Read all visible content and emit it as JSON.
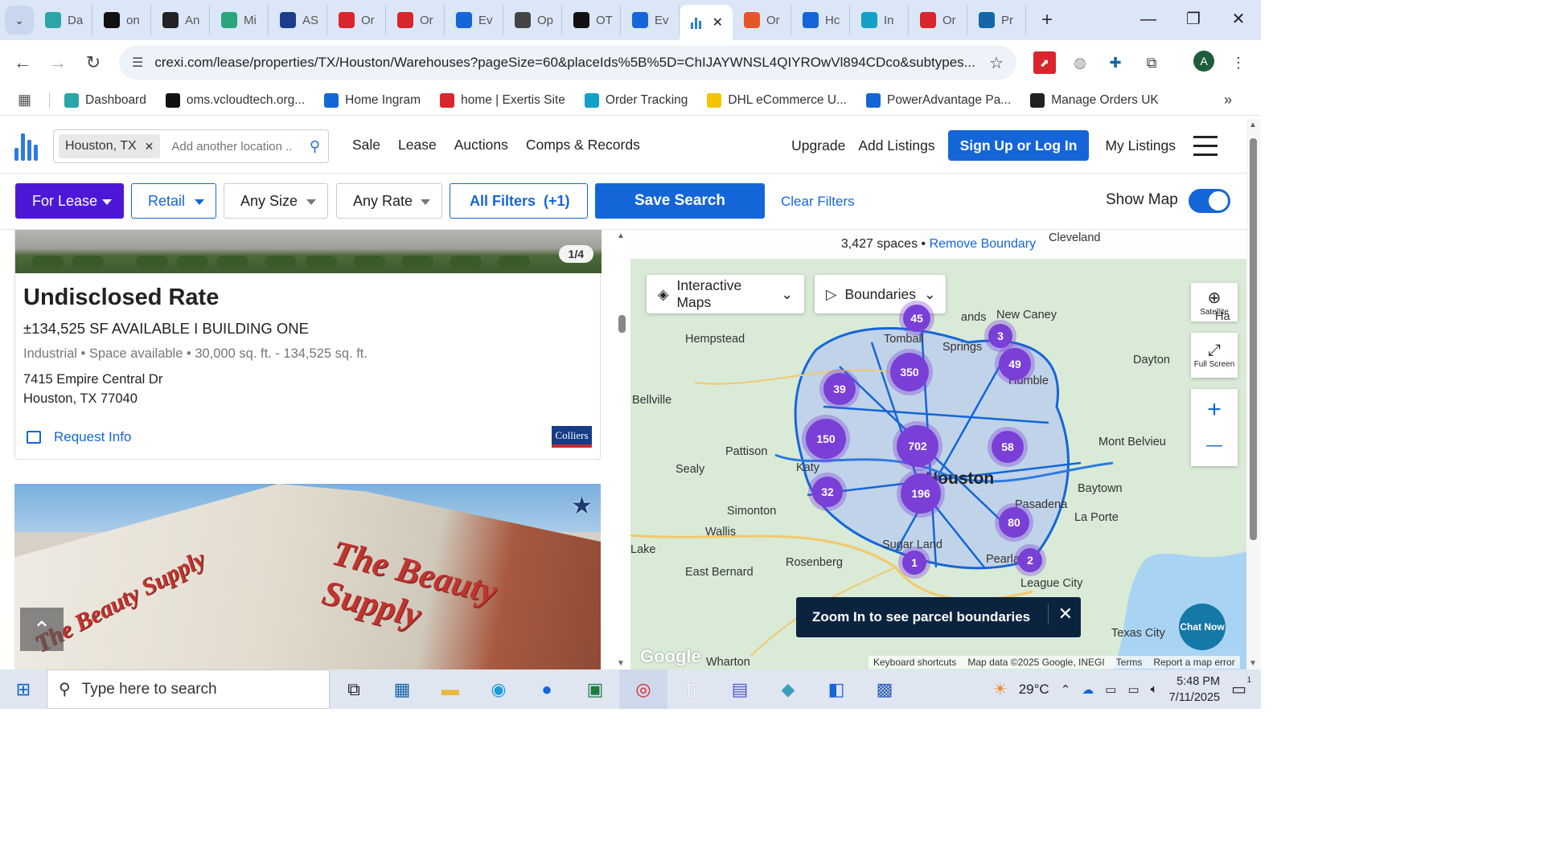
{
  "browser": {
    "tabs": [
      {
        "label": "Da",
        "color": "#2aa6a6"
      },
      {
        "label": "on",
        "color": "#111111"
      },
      {
        "label": "An",
        "color": "#222222"
      },
      {
        "label": "Mi",
        "color": "#2aa67a"
      },
      {
        "label": "AS",
        "color": "#1d3c8c"
      },
      {
        "label": "Or",
        "color": "#d8262c"
      },
      {
        "label": "Or",
        "color": "#d8262c"
      },
      {
        "label": "Ev",
        "color": "#1466d8"
      },
      {
        "label": "Op",
        "color": "#444444"
      },
      {
        "label": "OT",
        "color": "#111111"
      },
      {
        "label": "Ev",
        "color": "#1466d8"
      }
    ],
    "active_tab_close": "✕",
    "tabs_after": [
      {
        "label": "Or",
        "color": "#e8542a"
      },
      {
        "label": "Hc",
        "color": "#1466d8"
      },
      {
        "label": "In",
        "color": "#12a0c8"
      },
      {
        "label": "Or",
        "color": "#d8262c"
      },
      {
        "label": "Pr",
        "color": "#1466a8"
      }
    ],
    "url": "crexi.com/lease/properties/TX/Houston/Warehouses?pageSize=60&placeIds%5B%5D=ChIJAYWNSL4QIYROwVl894CDco&subtypes...",
    "avatar_letter": "A",
    "bookmarks": [
      {
        "label": "Dashboard",
        "color": "#2aa6a6"
      },
      {
        "label": "oms.vcloudtech.org...",
        "color": "#111111"
      },
      {
        "label": "Home Ingram",
        "color": "#1466d8"
      },
      {
        "label": "home | Exertis Site",
        "color": "#d8262c"
      },
      {
        "label": "Order Tracking",
        "color": "#12a0c8"
      },
      {
        "label": "DHL eCommerce U...",
        "color": "#f2c500"
      },
      {
        "label": "PowerAdvantage Pa...",
        "color": "#1466d8"
      },
      {
        "label": "Manage Orders UK",
        "color": "#222222"
      }
    ]
  },
  "site": {
    "location_chip": "Houston, TX",
    "location_placeholder": "Add another location ...",
    "nav": [
      "Sale",
      "Lease",
      "Auctions",
      "Comps & Records"
    ],
    "upgrade": "Upgrade",
    "add_listings": "Add Listings",
    "signup": "Sign Up or Log In",
    "my_listings": "My Listings"
  },
  "filters": {
    "for_lease": "For Lease",
    "retail": "Retail",
    "any_size": "Any Size",
    "any_rate": "Any Rate",
    "all_filters": "All Filters  (+1)",
    "save_search": "Save Search",
    "clear_filters": "Clear Filters",
    "show_map": "Show Map",
    "show_map_on": true
  },
  "listing1": {
    "pager": "1/4",
    "title": "Undisclosed Rate",
    "subtitle": "±134,525 SF AVAILABLE I BUILDING ONE",
    "meta": "Industrial • Space available • 30,000 sq. ft. - 134,525 sq. ft.",
    "address1": "7415 Empire Central Dr",
    "address2": "Houston, TX 77040",
    "request_info": "Request Info",
    "broker": "Colliers"
  },
  "listing2": {
    "sign_text": "The Beauty Supply"
  },
  "map": {
    "count": "3,427 spaces",
    "sep": " • ",
    "remove_boundary": "Remove Boundary",
    "interactive_maps": "Interactive Maps",
    "boundaries": "Boundaries",
    "satellite": "Satellite",
    "full_screen": "Full Screen",
    "zoom_in": "+",
    "zoom_out": "—",
    "clusters": [
      "45",
      "3",
      "49",
      "350",
      "39",
      "150",
      "702",
      "58",
      "32",
      "196",
      "80",
      "1",
      "2"
    ],
    "places": [
      "Hempstead",
      "Tomball",
      "New Caney",
      "Bellville",
      "Dayton",
      "Pattison",
      "Sealy",
      "Katy",
      "Mont Belvieu",
      "Houston",
      "Simonton",
      "Baytown",
      "Pasadena",
      "La Porte",
      "Wallis",
      "Sugar Land",
      "Rosenberg",
      "East Bernard",
      "Pearland",
      "League City",
      "Texas City",
      "Wharton",
      "Cleveland",
      "Lake",
      "Ha",
      "Springs",
      "ands",
      "Humble"
    ],
    "toast": "Zoom In to see parcel boundaries",
    "chat": "Chat Now",
    "google": "Google",
    "attribution": [
      "Keyboard shortcuts",
      "Map data ©2025 Google, INEGI",
      "Terms",
      "Report a map error"
    ]
  },
  "taskbar": {
    "search_placeholder": "Type here to search",
    "weather": "29°C",
    "time": "5:48 PM",
    "date": "7/11/2025",
    "notification_count": "1"
  },
  "colors": {
    "primary": "#1466d8",
    "for_lease": "#4c18d6",
    "cluster": "#7a3fd6",
    "toast_bg": "#0c2340"
  }
}
